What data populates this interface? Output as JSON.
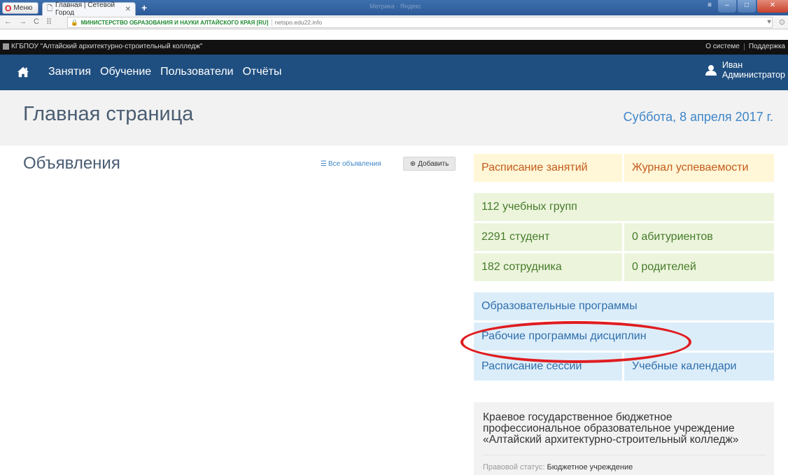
{
  "browser": {
    "menu_label": "Меню",
    "tab_title": "Главная | Сетевой Город",
    "window_title": "Метрика · Яндекс",
    "cert_label": "МИНИСТЕРСТВО ОБРАЗОВАНИЯ И НАУКИ АЛТАЙСКОГО КРАЯ [RU]",
    "host": "netspo.edu22.info"
  },
  "topbar": {
    "org": "КГБПОУ \"Алтайский архитектурно-строительный колледж\"",
    "links": [
      "О системе",
      "Поддержка"
    ]
  },
  "nav": {
    "items": [
      "Занятия",
      "Обучение",
      "Пользователи",
      "Отчёты"
    ],
    "user_first": "Иван",
    "user_role": "Администратор"
  },
  "header": {
    "title": "Главная страница",
    "date": "Суббота, 8 апреля 2017 г."
  },
  "announcements": {
    "title": "Объявления",
    "all_label": "Все объявления",
    "add_label": "Добавить"
  },
  "tiles": {
    "schedule": "Расписание занятий",
    "journal": "Журнал успеваемости",
    "groups": "112 учебных групп",
    "students": "2291 студент",
    "applicants": "0 абитуриентов",
    "staff": "182 сотрудника",
    "parents": "0 родителей",
    "programs": "Образовательные программы",
    "work_programs": "Рабочие программы дисциплин",
    "sessions": "Расписание сессий",
    "calendars": "Учебные календари"
  },
  "org_info": {
    "name": "Краевое государственное бюджетное профессиональное образовательное учреждение «Алтайский архитектурно-строительный колледж»",
    "status_label": "Правовой статус:",
    "status_value": "Бюджетное учреждение"
  },
  "colors": {
    "navbar": "#1f4f80",
    "accent": "#3f86c9",
    "highlight": "#e01c20"
  }
}
